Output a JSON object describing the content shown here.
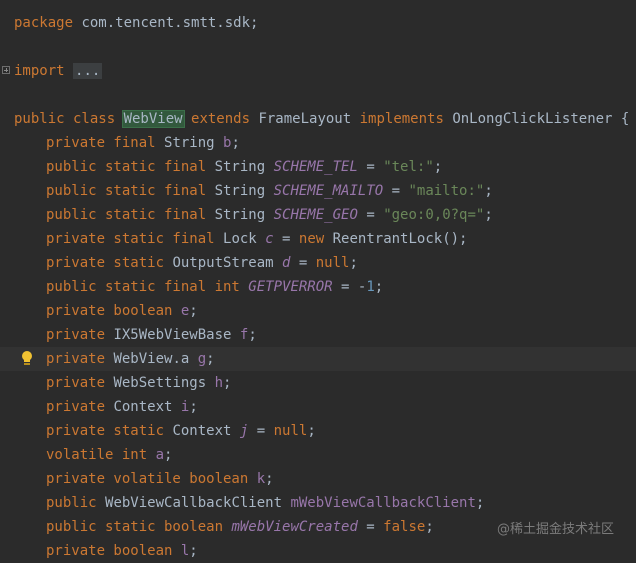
{
  "editor": {
    "lines": [
      [
        [
          "kw",
          "package"
        ],
        [
          "t",
          " com.tencent.smtt.sdk;"
        ]
      ],
      [],
      [
        [
          "kw",
          "import"
        ],
        [
          "t",
          " "
        ],
        [
          "fold",
          "..."
        ]
      ],
      [],
      [
        [
          "kw",
          "public class "
        ],
        [
          "hl",
          "WebView"
        ],
        [
          "kw",
          " extends "
        ],
        [
          "t",
          "FrameLayout "
        ],
        [
          "kw",
          "implements "
        ],
        [
          "t",
          "OnLongClickListener {"
        ]
      ],
      [
        [
          "kw",
          "private final "
        ],
        [
          "t",
          "String "
        ],
        [
          "fld",
          "b"
        ],
        [
          "t",
          ";"
        ]
      ],
      [
        [
          "kw",
          "public static final "
        ],
        [
          "t",
          "String "
        ],
        [
          "sfld",
          "SCHEME_TEL"
        ],
        [
          "t",
          " = "
        ],
        [
          "str",
          "\"tel:\""
        ],
        [
          "t",
          ";"
        ]
      ],
      [
        [
          "kw",
          "public static final "
        ],
        [
          "t",
          "String "
        ],
        [
          "sfld",
          "SCHEME_MAILTO"
        ],
        [
          "t",
          " = "
        ],
        [
          "str",
          "\"mailto:\""
        ],
        [
          "t",
          ";"
        ]
      ],
      [
        [
          "kw",
          "public static final "
        ],
        [
          "t",
          "String "
        ],
        [
          "sfld",
          "SCHEME_GEO"
        ],
        [
          "t",
          " = "
        ],
        [
          "str",
          "\"geo:0,0?q=\""
        ],
        [
          "t",
          ";"
        ]
      ],
      [
        [
          "kw",
          "private static final "
        ],
        [
          "t",
          "Lock "
        ],
        [
          "sfld",
          "c"
        ],
        [
          "t",
          " = "
        ],
        [
          "kw",
          "new "
        ],
        [
          "t",
          "ReentrantLock();"
        ]
      ],
      [
        [
          "kw",
          "private static "
        ],
        [
          "t",
          "OutputStream "
        ],
        [
          "sfld",
          "d"
        ],
        [
          "t",
          " = "
        ],
        [
          "kw",
          "null"
        ],
        [
          "t",
          ";"
        ]
      ],
      [
        [
          "kw",
          "public static final int "
        ],
        [
          "sfld",
          "GETPVERROR"
        ],
        [
          "t",
          " = -"
        ],
        [
          "num",
          "1"
        ],
        [
          "t",
          ";"
        ]
      ],
      [
        [
          "kw",
          "private boolean "
        ],
        [
          "fld",
          "e"
        ],
        [
          "t",
          ";"
        ]
      ],
      [
        [
          "kw",
          "private "
        ],
        [
          "t",
          "IX5WebViewBase "
        ],
        [
          "fld",
          "f"
        ],
        [
          "t",
          ";"
        ]
      ],
      [
        [
          "kw",
          "private "
        ],
        [
          "t",
          "WebView.a "
        ],
        [
          "fld",
          "g"
        ],
        [
          "t",
          ";"
        ]
      ],
      [
        [
          "kw",
          "private "
        ],
        [
          "t",
          "WebSettings "
        ],
        [
          "fld",
          "h"
        ],
        [
          "t",
          ";"
        ]
      ],
      [
        [
          "kw",
          "private "
        ],
        [
          "t",
          "Context "
        ],
        [
          "fld",
          "i"
        ],
        [
          "t",
          ";"
        ]
      ],
      [
        [
          "kw",
          "private static "
        ],
        [
          "t",
          "Context "
        ],
        [
          "sfld",
          "j"
        ],
        [
          "t",
          " = "
        ],
        [
          "kw",
          "null"
        ],
        [
          "t",
          ";"
        ]
      ],
      [
        [
          "kw",
          "volatile int "
        ],
        [
          "fld",
          "a"
        ],
        [
          "t",
          ";"
        ]
      ],
      [
        [
          "kw",
          "private volatile boolean "
        ],
        [
          "fld",
          "k"
        ],
        [
          "t",
          ";"
        ]
      ],
      [
        [
          "kw",
          "public "
        ],
        [
          "t",
          "WebViewCallbackClient "
        ],
        [
          "fld",
          "mWebViewCallbackClient"
        ],
        [
          "t",
          ";"
        ]
      ],
      [
        [
          "kw",
          "public static boolean "
        ],
        [
          "sfld",
          "mWebViewCreated"
        ],
        [
          "t",
          " = "
        ],
        [
          "kw",
          "false"
        ],
        [
          "t",
          ";"
        ]
      ],
      [
        [
          "kw",
          "private boolean "
        ],
        [
          "fld",
          "l"
        ],
        [
          "t",
          ";"
        ]
      ]
    ]
  },
  "icons": {
    "fold": "fold-expand-icon",
    "intention": "lightbulb-icon"
  },
  "colors": {
    "background": "#2b2b2b",
    "keyword": "#cc7832",
    "string": "#6a8759",
    "number": "#6897bb",
    "field": "#9876aa",
    "text": "#a9b7c6",
    "highlight": "#32593d"
  },
  "watermark": "@稀土掘金技术社区"
}
